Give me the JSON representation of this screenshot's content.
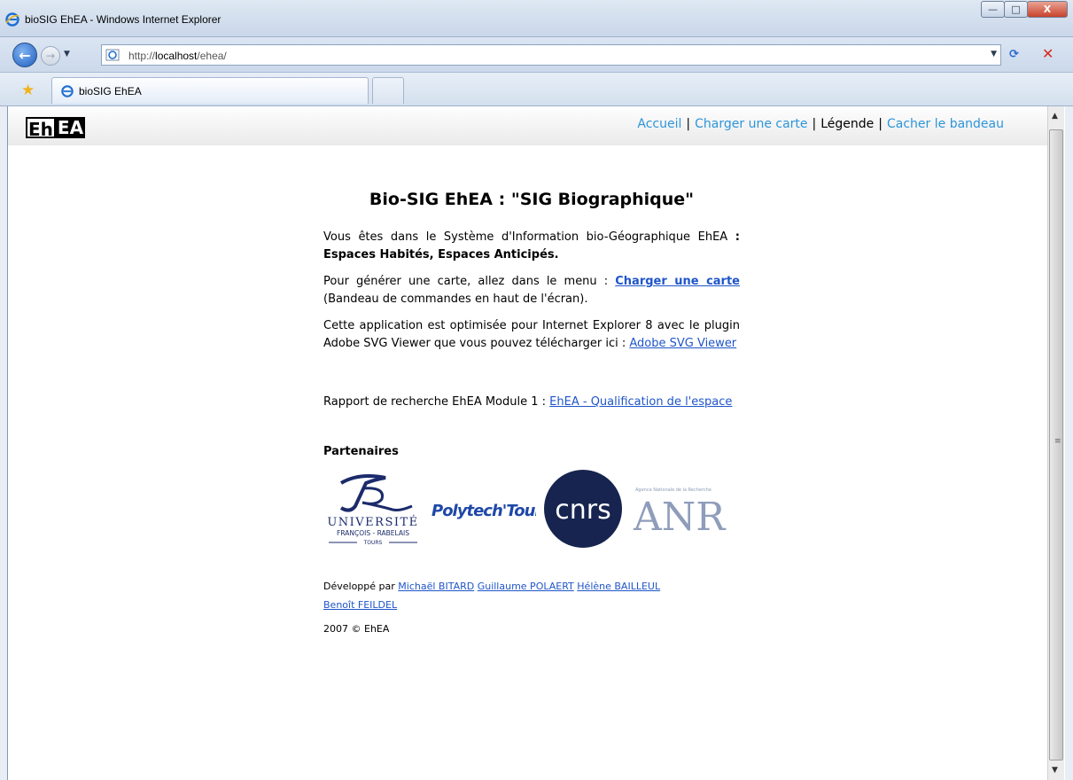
{
  "window": {
    "title": "bioSIG EhEA - Windows Internet Explorer",
    "controls": {
      "minimize": "—",
      "maximize": "□",
      "close": "X"
    }
  },
  "addressbar": {
    "url_prefix": "http://",
    "url_host": "localhost",
    "url_path": "/ehea/"
  },
  "tabs": [
    {
      "label": "bioSIG EhEA"
    }
  ],
  "header": {
    "logo_left": "Eh",
    "logo_right": "EA",
    "nav": {
      "accueil": "Accueil",
      "charger": "Charger une carte",
      "legende": "Légende",
      "cacher": "Cacher le bandeau",
      "sep": "|"
    }
  },
  "main": {
    "title": "Bio-SIG EhEA : \"SIG Biographique\"",
    "p1_text": "Vous êtes dans le Système d'Information bio-Géographique EhEA ",
    "p1_bold": ": Espaces Habités, Espaces Anticipés.",
    "p2_text": "Pour générer une carte, allez dans le menu : ",
    "p2_link": "Charger une carte",
    "p2_rest": " (Bandeau de commandes en haut de l'écran).",
    "p3_text": "Cette application est optimisée pour Internet Explorer 8 avec le plugin Adobe SVG Viewer que vous pouvez télécharger ici : ",
    "p3_link": "Adobe SVG Viewer",
    "p4_text": "Rapport de recherche EhEA Module 1 : ",
    "p4_link": "EhEA - Qualification de l'espace",
    "partners_title": "Partenaires",
    "partner_logos": {
      "univ_line1": "UNIVERSITÉ",
      "univ_line2": "FRANÇOIS - RABELAIS",
      "univ_line3": "TOURS",
      "polytech": "Polytech'Tours",
      "cnrs": "cnrs",
      "anr_small": "Agence Nationale de la Recherche",
      "anr": "ANR"
    },
    "dev_prefix": "Développé par ",
    "developers": [
      "Michaël BITARD",
      "Guillaume POLAERT",
      "Hélène BAILLEUL",
      "Benoît FEILDEL"
    ],
    "copyright": "2007 © EhEA"
  },
  "colors": {
    "link": "#1f55c9",
    "nav_link": "#2d95da"
  }
}
